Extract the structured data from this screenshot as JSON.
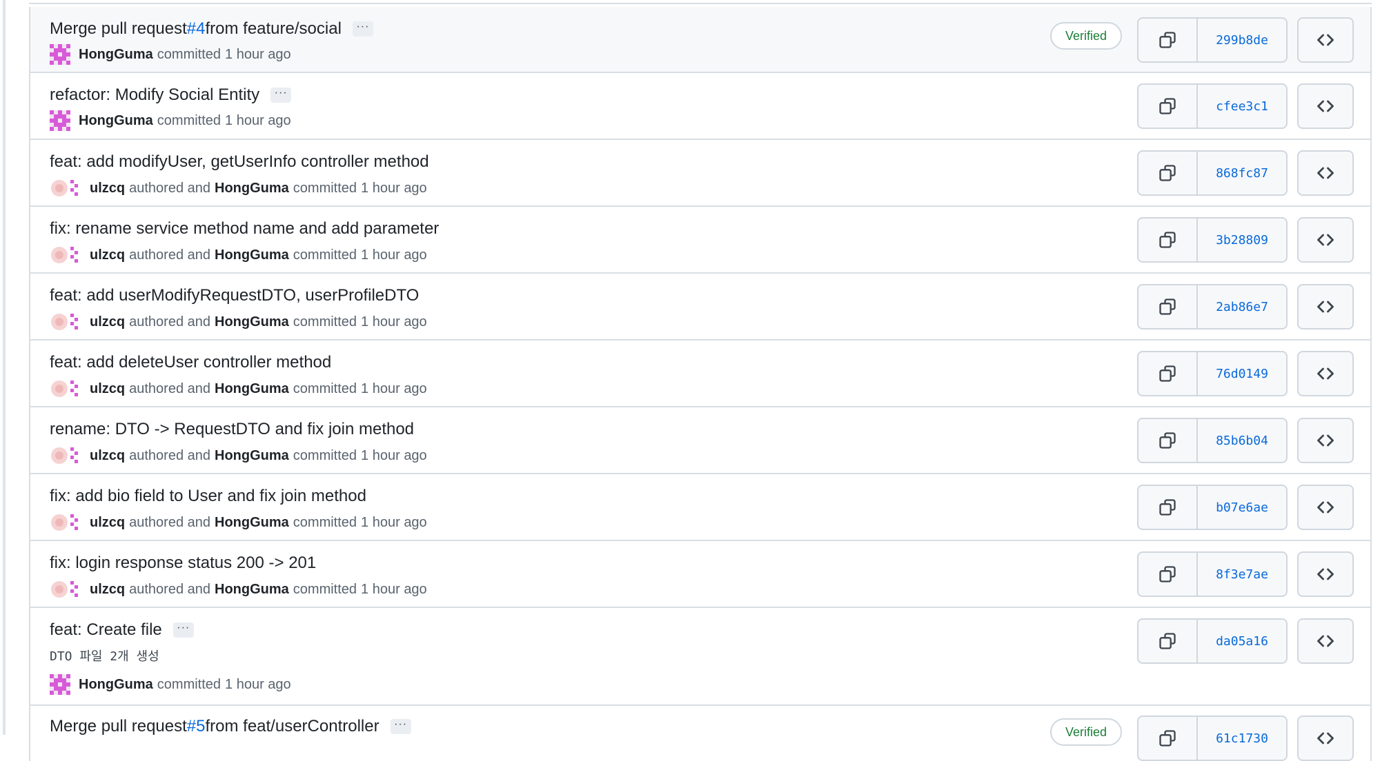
{
  "commits": [
    {
      "title_prefix": "Merge pull request ",
      "pr_number": "#4",
      "title_suffix": " from feature/social",
      "has_ellipsis": true,
      "ellipsis": "···",
      "verified": "Verified",
      "author": "HongGuma",
      "committed": "committed",
      "time": "1 hour ago",
      "sha": "299b8de"
    },
    {
      "title": "refactor: Modify Social Entity",
      "has_ellipsis": true,
      "ellipsis": "···",
      "author": "HongGuma",
      "committed": "committed",
      "time": "1 hour ago",
      "sha": "cfee3c1"
    },
    {
      "title": "feat: add modifyUser, getUserInfo controller method",
      "author": "ulzcq",
      "authored_and": "authored and",
      "committer": "HongGuma",
      "committed": "committed",
      "time": "1 hour ago",
      "sha": "868fc87"
    },
    {
      "title": "fix: rename service method name and add parameter",
      "author": "ulzcq",
      "authored_and": "authored and",
      "committer": "HongGuma",
      "committed": "committed",
      "time": "1 hour ago",
      "sha": "3b28809"
    },
    {
      "title": "feat: add userModifyRequestDTO, userProfileDTO",
      "author": "ulzcq",
      "authored_and": "authored and",
      "committer": "HongGuma",
      "committed": "committed",
      "time": "1 hour ago",
      "sha": "2ab86e7"
    },
    {
      "title": "feat: add deleteUser controller method",
      "author": "ulzcq",
      "authored_and": "authored and",
      "committer": "HongGuma",
      "committed": "committed",
      "time": "1 hour ago",
      "sha": "76d0149"
    },
    {
      "title": "rename: DTO -> RequestDTO and fix join method",
      "author": "ulzcq",
      "authored_and": "authored and",
      "committer": "HongGuma",
      "committed": "committed",
      "time": "1 hour ago",
      "sha": "85b6b04"
    },
    {
      "title": "fix: add bio field to User and fix join method",
      "author": "ulzcq",
      "authored_and": "authored and",
      "committer": "HongGuma",
      "committed": "committed",
      "time": "1 hour ago",
      "sha": "b07e6ae"
    },
    {
      "title": "fix: login response status 200 -> 201",
      "author": "ulzcq",
      "authored_and": "authored and",
      "committer": "HongGuma",
      "committed": "committed",
      "time": "1 hour ago",
      "sha": "8f3e7ae"
    },
    {
      "title": "feat: Create file",
      "has_ellipsis": true,
      "ellipsis": "···",
      "description": "DTO 파일 2개 생성",
      "author": "HongGuma",
      "committed": "committed",
      "time": "1 hour ago",
      "sha": "da05a16"
    },
    {
      "title_prefix": "Merge pull request ",
      "pr_number": "#5",
      "title_suffix": " from feat/userController",
      "has_ellipsis": true,
      "ellipsis": "···",
      "verified": "Verified",
      "sha": "61c1730"
    }
  ],
  "icons": {
    "copy": "copy-icon",
    "browse": "code-icon",
    "avatar": "identicon-avatar"
  },
  "colors": {
    "link": "#0969da",
    "verified": "#1a7f37",
    "avatar_magenta": "#d85ad8",
    "row_highlight": "#f6f8fa",
    "border": "#d0d7de"
  }
}
